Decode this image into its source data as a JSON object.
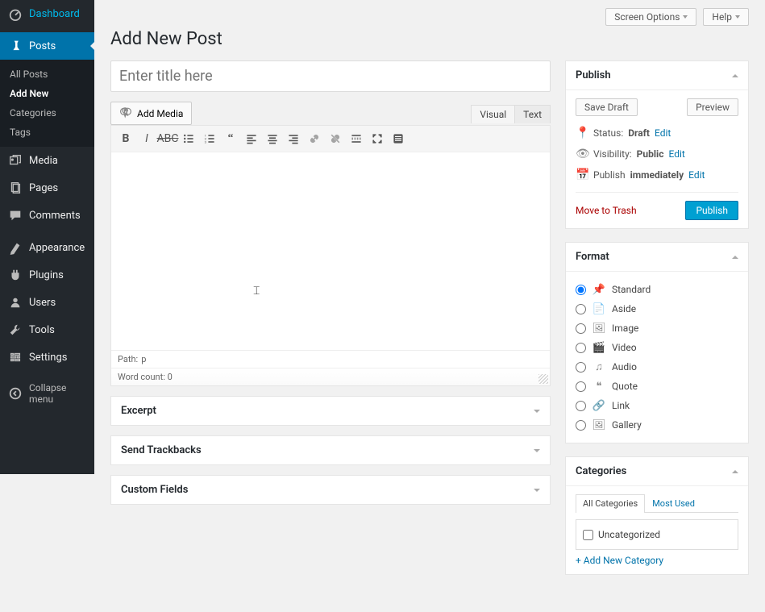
{
  "topbar": {
    "screen_options": "Screen Options",
    "help": "Help"
  },
  "sidebar": {
    "items": [
      {
        "label": "Dashboard",
        "icon": "dashboard"
      },
      {
        "label": "Posts",
        "icon": "pin",
        "current": true,
        "children": [
          {
            "label": "All Posts"
          },
          {
            "label": "Add New",
            "active": true
          },
          {
            "label": "Categories"
          },
          {
            "label": "Tags"
          }
        ]
      },
      {
        "label": "Media",
        "icon": "media"
      },
      {
        "label": "Pages",
        "icon": "pages"
      },
      {
        "label": "Comments",
        "icon": "comments"
      },
      {
        "label": "Appearance",
        "icon": "appearance"
      },
      {
        "label": "Plugins",
        "icon": "plugins"
      },
      {
        "label": "Users",
        "icon": "users"
      },
      {
        "label": "Tools",
        "icon": "tools"
      },
      {
        "label": "Settings",
        "icon": "settings"
      }
    ],
    "collapse": "Collapse menu"
  },
  "page": {
    "title": "Add New Post"
  },
  "editor": {
    "title_placeholder": "Enter title here",
    "add_media": "Add Media",
    "tabs": {
      "visual": "Visual",
      "text": "Text"
    },
    "path_label": "Path:",
    "path_value": "p",
    "wordcount": "Word count: 0"
  },
  "metaboxes": {
    "excerpt": "Excerpt",
    "trackbacks": "Send Trackbacks",
    "custom_fields": "Custom Fields"
  },
  "publish": {
    "title": "Publish",
    "save_draft": "Save Draft",
    "preview": "Preview",
    "status_label": "Status:",
    "status_value": "Draft",
    "visibility_label": "Visibility:",
    "visibility_value": "Public",
    "schedule_label": "Publish",
    "schedule_value": "immediately",
    "edit": "Edit",
    "trash": "Move to Trash",
    "publish_btn": "Publish"
  },
  "format": {
    "title": "Format",
    "options": [
      "Standard",
      "Aside",
      "Image",
      "Video",
      "Audio",
      "Quote",
      "Link",
      "Gallery"
    ]
  },
  "categories": {
    "title": "Categories",
    "tabs": {
      "all": "All Categories",
      "most": "Most Used"
    },
    "items": [
      "Uncategorized"
    ],
    "add_new": "+ Add New Category"
  }
}
